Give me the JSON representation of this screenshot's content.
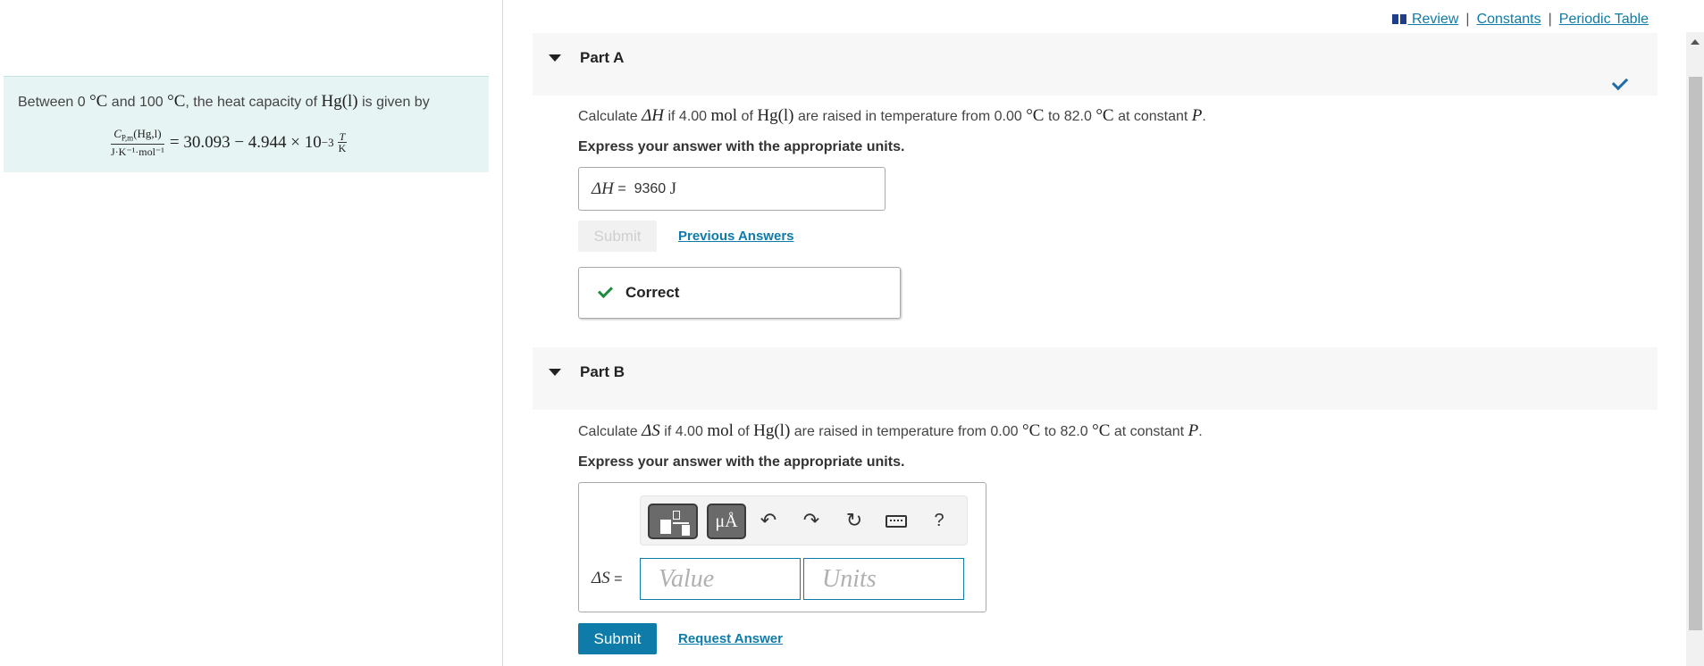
{
  "intro": {
    "prefix": "Between 0",
    "deg1": "°C",
    "and": "and 100",
    "deg2": "°C",
    "mid": ", the heat capacity of",
    "substance": "Hg(l)",
    "suffix": "is given by",
    "formula_numerator": "C",
    "formula_numerator_sub": "P,m",
    "formula_numerator_rest": "(Hg,l)",
    "formula_denominator": "J·K⁻¹·mol⁻¹",
    "formula_rhs": "= 30.093 − 4.944 × 10",
    "formula_exp": "−3",
    "formula_T": "T",
    "formula_K": "K"
  },
  "top_links": {
    "review": "Review",
    "sep1": "|",
    "constants": "Constants",
    "sep2": "|",
    "periodic_table": "Periodic Table"
  },
  "partA": {
    "title": "Part A",
    "q_pre": "Calculate",
    "q_symbol": "ΔH",
    "q_if": "if 4.00",
    "q_mol": "mol",
    "q_of": "of",
    "q_sub": "Hg(l)",
    "q_mid": "are raised in temperature from 0.00",
    "q_deg1": "°C",
    "q_to": "to 82.0",
    "q_deg2": "°C",
    "q_at": "at constant",
    "q_P": "P",
    "q_dot": ".",
    "instruction": "Express your answer with the appropriate units.",
    "answer_symbol": "ΔH",
    "answer_eq": "=",
    "answer_value": "9360",
    "answer_unit": "J",
    "submit_label": "Submit",
    "previous_answers": "Previous Answers",
    "feedback": "Correct"
  },
  "partB": {
    "title": "Part B",
    "q_pre": "Calculate",
    "q_symbol": "ΔS",
    "q_if": "if 4.00",
    "q_mol": "mol",
    "q_of": "of",
    "q_sub": "Hg(l)",
    "q_mid": "are raised in temperature from 0.00",
    "q_deg1": "°C",
    "q_to": "to 82.0",
    "q_deg2": "°C",
    "q_at": "at constant",
    "q_P": "P",
    "q_dot": ".",
    "instruction": "Express your answer with the appropriate units.",
    "answer_symbol": "ΔS",
    "answer_eq": "=",
    "value_placeholder": "Value",
    "units_placeholder": "Units",
    "units_tool": "μÅ",
    "help": "?",
    "submit_label": "Submit",
    "request_answer": "Request Answer"
  },
  "icons": {
    "undo": "↶",
    "redo": "↷",
    "reset": "↻"
  },
  "colors": {
    "link": "#0f7ba8",
    "submit_bg": "#0f7ba8",
    "correct_check": "#1e8a3c",
    "intro_bg": "#e6f4f3"
  }
}
